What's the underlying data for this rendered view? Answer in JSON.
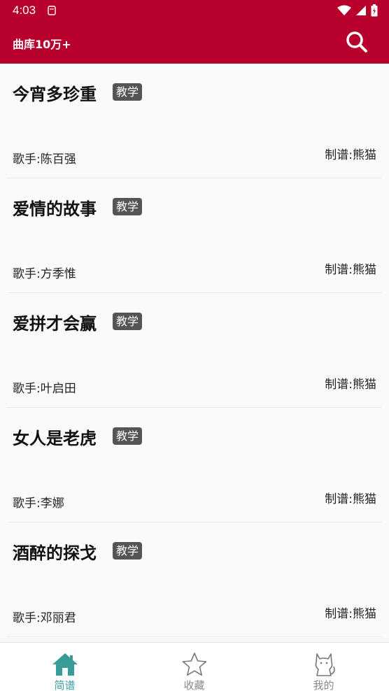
{
  "status_bar": {
    "time": "4:03"
  },
  "app_bar": {
    "title": "曲库10万+"
  },
  "songs": [
    {
      "title": "今宵多珍重",
      "tag": "教学",
      "singer": "歌手:陈百强",
      "maker": "制谱:熊猫"
    },
    {
      "title": "爱情的故事",
      "tag": "教学",
      "singer": "歌手:方季惟",
      "maker": "制谱:熊猫"
    },
    {
      "title": "爱拼才会赢",
      "tag": "教学",
      "singer": "歌手:叶启田",
      "maker": "制谱:熊猫"
    },
    {
      "title": "女人是老虎",
      "tag": "教学",
      "singer": "歌手:李娜",
      "maker": "制谱:熊猫"
    },
    {
      "title": "酒醉的探戈",
      "tag": "教学",
      "singer": "歌手:邓丽君",
      "maker": "制谱:熊猫"
    }
  ],
  "bottom_nav": {
    "items": [
      {
        "label": "简谱",
        "icon": "home-icon",
        "active": true
      },
      {
        "label": "收藏",
        "icon": "star-icon",
        "active": false
      },
      {
        "label": "我的",
        "icon": "cat-icon",
        "active": false
      }
    ]
  },
  "colors": {
    "brand": "#b8002c",
    "accent": "#3a9b9b"
  }
}
